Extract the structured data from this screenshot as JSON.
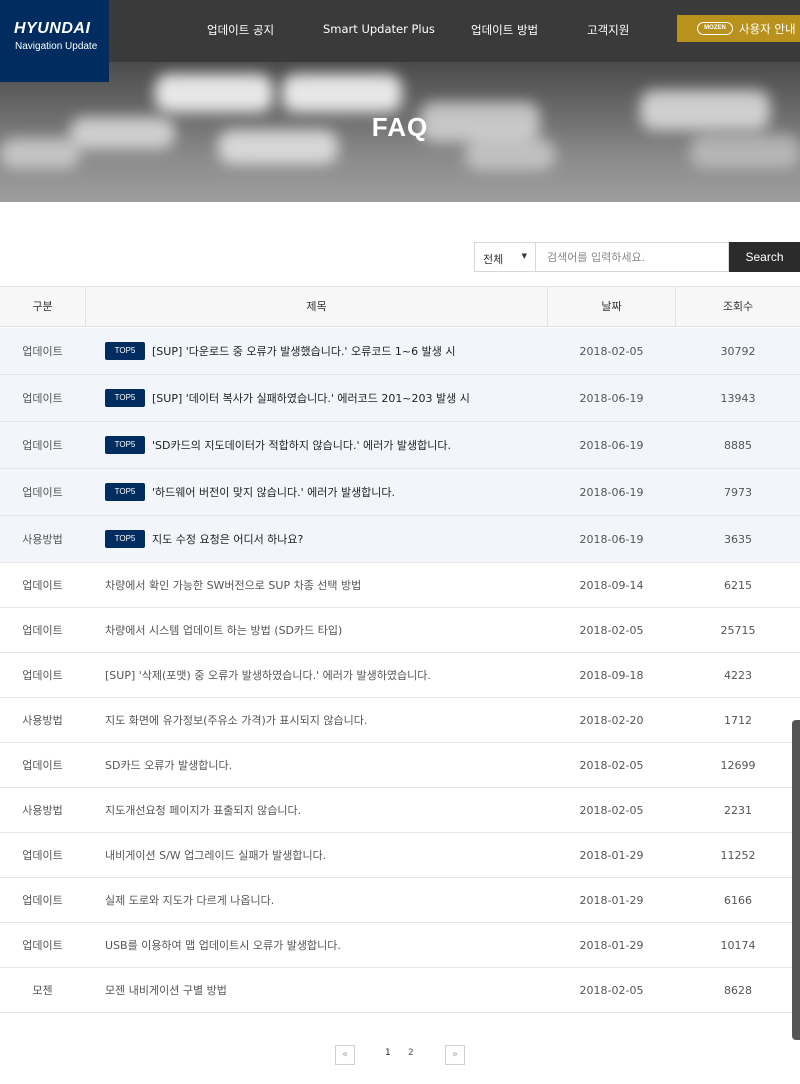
{
  "brand": {
    "name": "HYUNDAI",
    "sub": "Navigation Update",
    "color": "#002c5f"
  },
  "nav": [
    {
      "label": "업데이트 공지"
    },
    {
      "label": "Smart Updater Plus"
    },
    {
      "label": "업데이트 방법"
    },
    {
      "label": "고객지원"
    }
  ],
  "user_guide": {
    "badge": "MOZEN",
    "label": "사용자 안내",
    "color": "#b8921c"
  },
  "hero": {
    "title": "FAQ"
  },
  "search": {
    "select_value": "전체",
    "placeholder": "검색어를 입력하세요.",
    "button": "Search"
  },
  "table": {
    "headers": [
      "구분",
      "제목",
      "날짜",
      "조회수"
    ],
    "rows": [
      {
        "category": "업데이트",
        "badge": "TOP5",
        "title": "[SUP] '다운로드 중 오류가 발생했습니다.' 오류코드 1~6 발생 시",
        "date": "2018-02-05",
        "views": "30792"
      },
      {
        "category": "업데이트",
        "badge": "TOP5",
        "title": "[SUP] '데이터 복사가 실패하였습니다.' 에러코드 201~203 발생 시",
        "date": "2018-06-19",
        "views": "13943"
      },
      {
        "category": "업데이트",
        "badge": "TOP5",
        "title": "'SD카드의 지도데이터가 적합하지 않습니다.' 에러가 발생합니다.",
        "date": "2018-06-19",
        "views": "8885"
      },
      {
        "category": "업데이트",
        "badge": "TOP5",
        "title": "'하드웨어 버전이 맞지 않습니다.' 에러가 발생합니다.",
        "date": "2018-06-19",
        "views": "7973"
      },
      {
        "category": "사용방법",
        "badge": "TOP5",
        "title": "지도 수정 요청은 어디서 하나요?",
        "date": "2018-06-19",
        "views": "3635"
      },
      {
        "category": "업데이트",
        "badge": "",
        "title": "차량에서 확인 가능한 SW버전으로 SUP 차종 선택 방법",
        "date": "2018-09-14",
        "views": "6215"
      },
      {
        "category": "업데이트",
        "badge": "",
        "title": "차량에서 시스템 업데이트 하는 방법 (SD카드 타입)",
        "date": "2018-02-05",
        "views": "25715"
      },
      {
        "category": "업데이트",
        "badge": "",
        "title": "[SUP] '삭제(포맷) 중 오류가 발생하였습니다.' 에러가 발생하였습니다.",
        "date": "2018-09-18",
        "views": "4223"
      },
      {
        "category": "사용방법",
        "badge": "",
        "title": "지도 화면에 유가정보(주유소 가격)가 표시되지 않습니다.",
        "date": "2018-02-20",
        "views": "1712"
      },
      {
        "category": "업데이트",
        "badge": "",
        "title": "SD카드 오류가 발생합니다.",
        "date": "2018-02-05",
        "views": "12699"
      },
      {
        "category": "사용방법",
        "badge": "",
        "title": "지도개선요청 페이지가 표출되지 않습니다.",
        "date": "2018-02-05",
        "views": "2231"
      },
      {
        "category": "업데이트",
        "badge": "",
        "title": "내비게이션 S/W 업그레이드 실패가 발생합니다.",
        "date": "2018-01-29",
        "views": "11252"
      },
      {
        "category": "업데이트",
        "badge": "",
        "title": "실제 도로와 지도가 다르게 나옵니다.",
        "date": "2018-01-29",
        "views": "6166"
      },
      {
        "category": "업데이트",
        "badge": "",
        "title": "USB를 이용하여 맵 업데이트시 오류가 발생합니다.",
        "date": "2018-01-29",
        "views": "10174"
      },
      {
        "category": "모젠",
        "badge": "",
        "title": "모젠 내비게이션 구별 방법",
        "date": "2018-02-05",
        "views": "8628"
      }
    ]
  },
  "pagination": {
    "prev": "«",
    "next": "»",
    "pages": [
      "1",
      "2"
    ],
    "current": "1"
  }
}
